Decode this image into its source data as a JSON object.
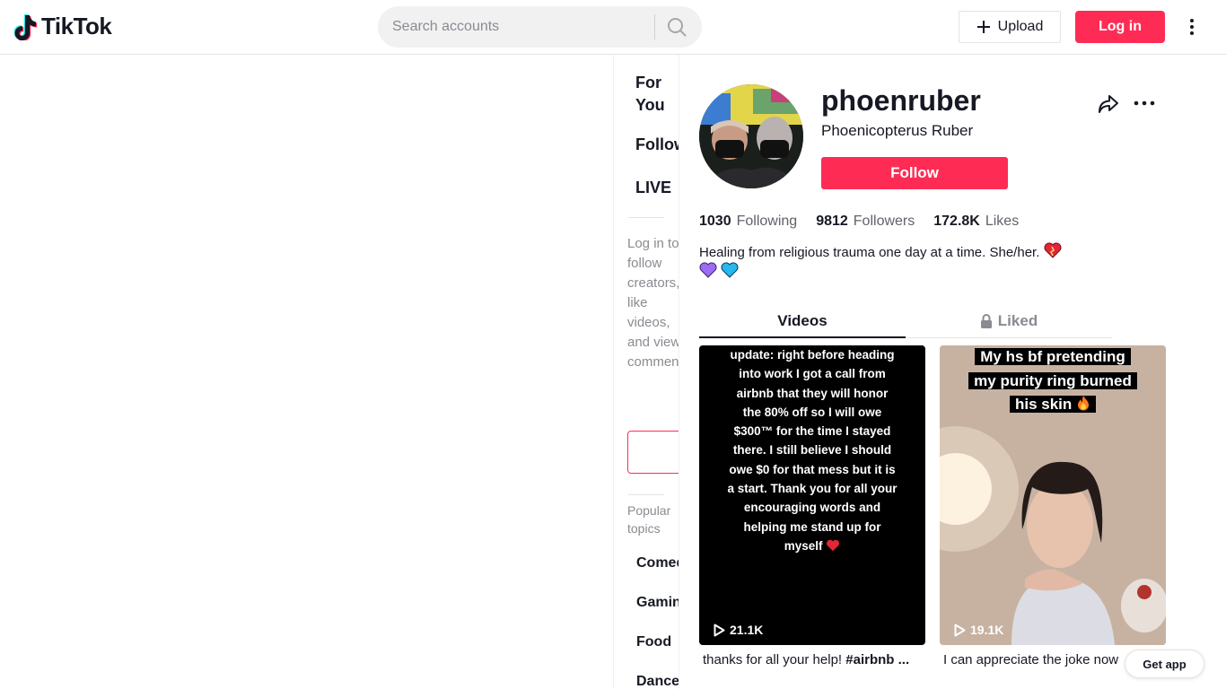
{
  "header": {
    "logo_text": "TikTok",
    "search_placeholder": "Search accounts",
    "upload_label": "Upload",
    "login_label": "Log in"
  },
  "sidebar": {
    "nav": [
      {
        "label": "For You"
      },
      {
        "label": "Following"
      },
      {
        "label": "LIVE"
      }
    ],
    "login_prompt": "Log in to follow creators, like videos, and view comments.",
    "popular_topics_title": "Popular topics",
    "topics": [
      "Comedy",
      "Gaming",
      "Food",
      "Dance"
    ]
  },
  "profile": {
    "username": "phoenruber",
    "display_name": "Phoenicopterus Ruber",
    "follow_label": "Follow",
    "stats": {
      "following_count": "1030",
      "following_label": "Following",
      "followers_count": "9812",
      "followers_label": "Followers",
      "likes_count": "172.8K",
      "likes_label": "Likes"
    },
    "bio": "Healing from religious trauma one day at a time. She/her."
  },
  "tabs": {
    "videos_label": "Videos",
    "liked_label": "Liked"
  },
  "videos": [
    {
      "overlay_text": "update: right before heading into work I got a call from airbnb that they will honor the 80% off so I will owe $300™ for the time I stayed there. I still believe I should owe $0 for that mess but it is a start. Thank you for all your encouraging words and helping me stand up for myself",
      "views": "21.1K",
      "description": "thanks for all your help!",
      "hashtag": "#airbnb ..."
    },
    {
      "overlay_lines": [
        "My hs bf pretending",
        "my purity ring burned",
        "his skin"
      ],
      "views": "19.1K",
      "description": "I can appreciate the joke now"
    }
  ],
  "get_app_label": "Get app",
  "colors": {
    "brand": "#fe2c55",
    "text": "#161823",
    "muted": "#8a8b91"
  }
}
